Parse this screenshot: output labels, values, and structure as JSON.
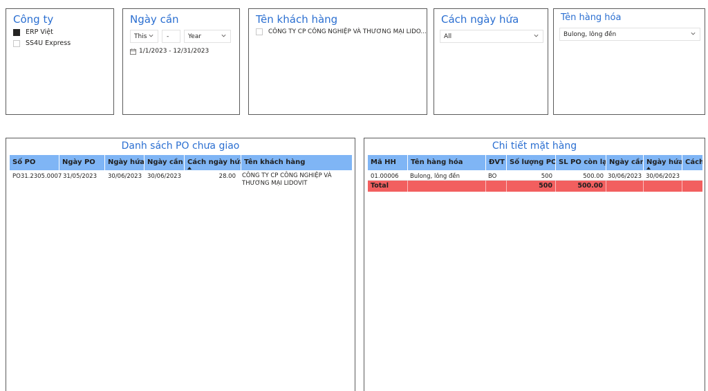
{
  "slicers": {
    "company": {
      "title": "Công ty",
      "items": [
        {
          "label": "ERP Việt",
          "checked": true
        },
        {
          "label": "SS4U Express",
          "checked": false
        }
      ]
    },
    "date_needed": {
      "title": "Ngày cần",
      "mode": "This",
      "count": "-",
      "unit": "Year",
      "range": "1/1/2023 - 12/31/2023"
    },
    "customer": {
      "title": "Tên khách hàng",
      "item": "CÔNG TY CP CÔNG NGHIỆP VÀ THƯƠNG MẠI LIDO..."
    },
    "promise_gap": {
      "title": "Cách ngày hứa",
      "value": "All"
    },
    "product": {
      "title": "Tên hàng hóa",
      "value": "Bulong, lông đền"
    }
  },
  "po_table": {
    "title": "Danh sách PO chưa giao",
    "headers": [
      "Số PO",
      "Ngày PO",
      "Ngày hứa",
      "Ngày cần",
      "Cách ngày hứa",
      "Tên khách hàng"
    ],
    "rows": [
      {
        "po": "PO31.2305.0007",
        "po_date": "31/05/2023",
        "promise_date": "30/06/2023",
        "need_date": "30/06/2023",
        "gap": "28.00",
        "customer": "CÔNG TY CP CÔNG NGHIỆP VÀ THƯƠNG MẠI LIDOVIT"
      }
    ]
  },
  "item_table": {
    "title": "Chi tiết mặt hàng",
    "headers": [
      "Mã HH",
      "Tên hàng hóa",
      "ĐVT",
      "Số lượng PO",
      "SL PO còn lại",
      "Ngày cần",
      "Ngày hứa",
      "Cách"
    ],
    "rows": [
      {
        "code": "01.00006",
        "name": "Bulong, lông đền",
        "unit": "BO",
        "qty": "500",
        "remaining": "500.00",
        "need_date": "30/06/2023",
        "promise_date": "30/06/2023",
        "gap": ""
      }
    ],
    "total": {
      "label": "Total",
      "qty": "500",
      "remaining": "500.00"
    }
  },
  "colors": {
    "title_blue": "#2b6fd1",
    "header_blue": "#7fb5f5",
    "total_red": "#f25f5f"
  }
}
